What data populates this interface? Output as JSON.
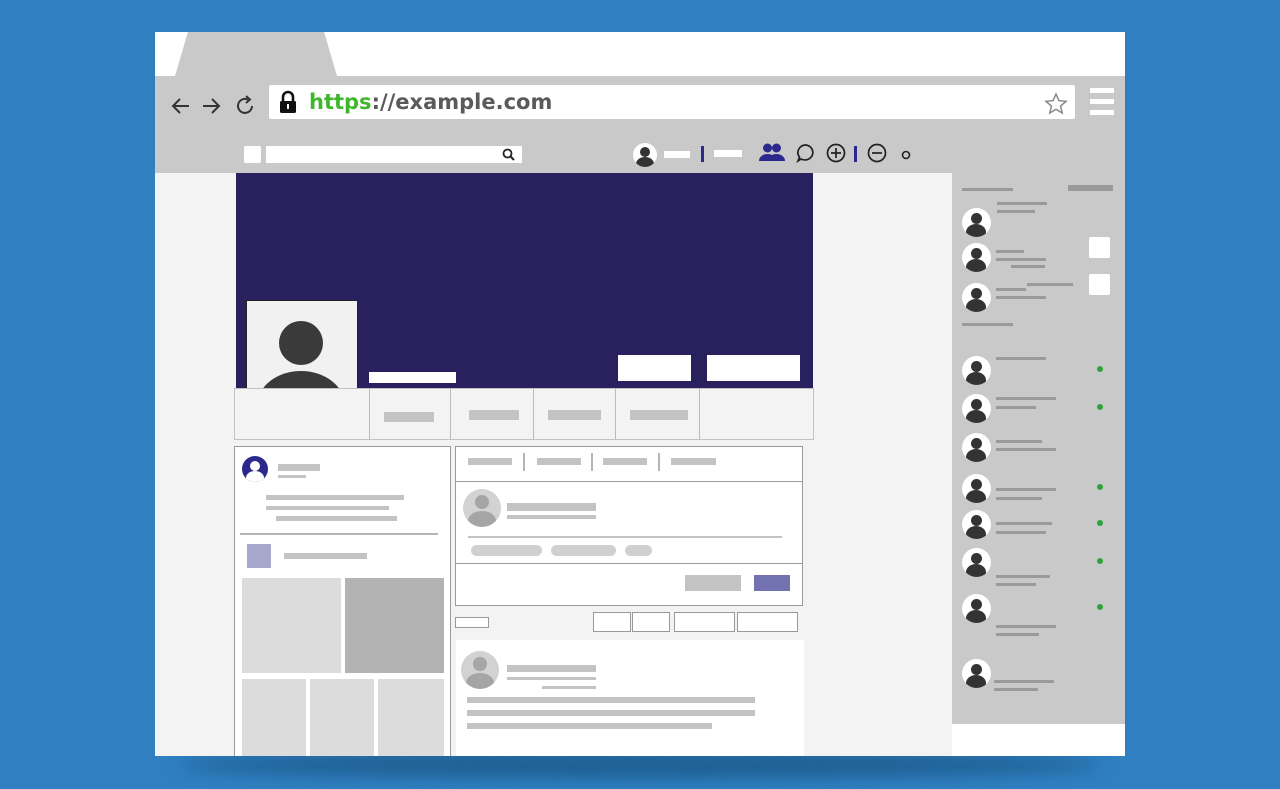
{
  "colors": {
    "background": "#2f7fc1",
    "url_https": "#3fb72a",
    "cover": "#29215e",
    "accent": "#2b2a8c",
    "online": "#2ea43b",
    "chrome": "#c9c9c9"
  },
  "browser": {
    "url_scheme": "https",
    "url_rest": "://example.com",
    "icons": {
      "back": "arrow-left-icon",
      "forward": "arrow-right-icon",
      "reload": "reload-icon",
      "lock": "lock-icon",
      "bookmark": "star-icon",
      "menu": "hamburger-menu-icon"
    }
  },
  "site_toolbar": {
    "icons": {
      "search": "search-icon",
      "friends": "friends-icon",
      "messages": "chat-bubble-icon",
      "create": "plus-circle-icon",
      "zoom_out": "minus-circle-icon",
      "notifications": "dot-icon"
    }
  },
  "contacts": {
    "online_status": [
      false,
      false,
      false,
      true,
      true,
      false,
      true,
      true,
      true,
      true,
      false
    ]
  }
}
